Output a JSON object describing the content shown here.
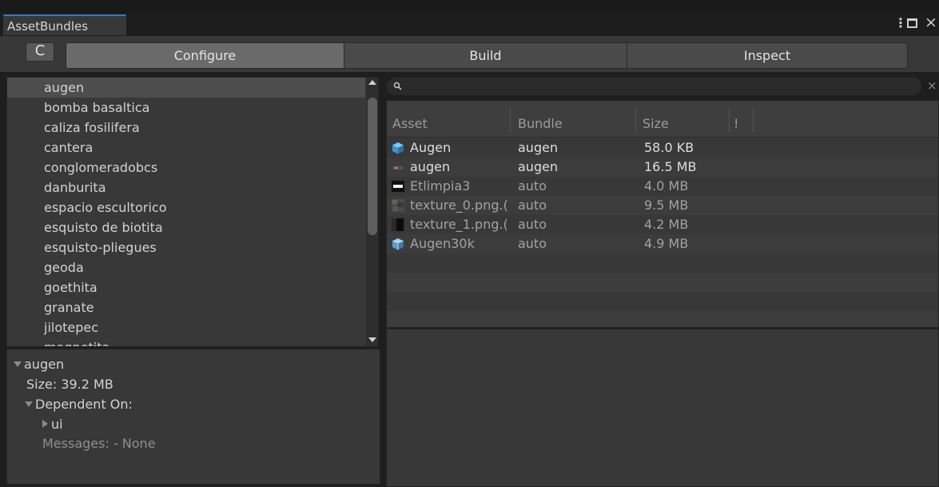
{
  "window": {
    "tab_title": "AssetBundles",
    "menu_icon": "⋮",
    "close_icon": "×"
  },
  "toolbar": {
    "refresh_icon": "C",
    "tabs": [
      {
        "label": "Configure",
        "selected": true
      },
      {
        "label": "Build",
        "selected": false
      },
      {
        "label": "Inspect",
        "selected": false
      }
    ]
  },
  "bundle_list": {
    "items": [
      "augen",
      "bomba basaltica",
      "caliza fosilifera",
      "cantera",
      "conglomeradobcs",
      "danburita",
      "espacio escultorico",
      "esquisto de biotita",
      "esquisto-pliegues",
      "geoda",
      "goethita",
      "granate",
      "jilotepec",
      "magnetita"
    ],
    "selected_index": 0
  },
  "details": {
    "bundle_name": "augen",
    "size_text": "Size: 39.2 MB",
    "dependent_on_label": "Dependent On:",
    "dependency": "ui",
    "messages_text": "Messages: - None"
  },
  "search": {
    "placeholder": "",
    "clear_icon": "×"
  },
  "asset_table": {
    "columns": [
      "Asset",
      "Bundle",
      "Size",
      "!"
    ],
    "rows": [
      {
        "asset": "Augen",
        "bundle": "augen",
        "size": "58.0 KB",
        "icon": "prefab-icon",
        "dimmed": false
      },
      {
        "asset": "augen",
        "bundle": "augen",
        "size": "16.5 MB",
        "icon": "texture-icon",
        "dimmed": false
      },
      {
        "asset": "Etlimpia3",
        "bundle": "auto",
        "size": "4.0 MB",
        "icon": "image-icon",
        "dimmed": true
      },
      {
        "asset": "texture_0.png.(",
        "bundle": "auto",
        "size": "9.5 MB",
        "icon": "texture-icon",
        "dimmed": true
      },
      {
        "asset": "texture_1.png.(",
        "bundle": "auto",
        "size": "4.2 MB",
        "icon": "texture-icon",
        "dimmed": true
      },
      {
        "asset": "Augen30k",
        "bundle": "auto",
        "size": "4.9 MB",
        "icon": "mesh-icon",
        "dimmed": true
      }
    ]
  }
}
